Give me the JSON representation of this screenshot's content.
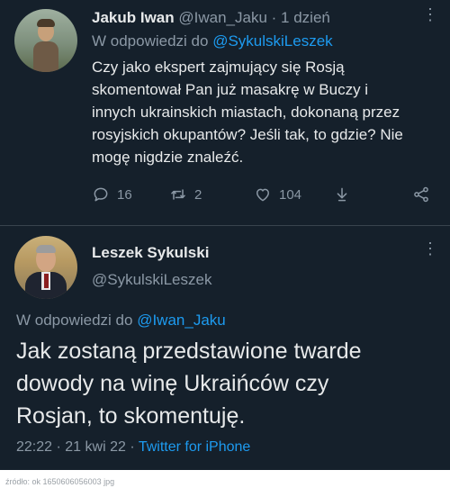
{
  "reply_tweet": {
    "author_name": "Jakub Iwan",
    "author_handle": "@Iwan_Jaku",
    "time_separator": "·",
    "time": "1 dzień",
    "replying_to_prefix": "W odpowiedzi do",
    "replying_to_handle": "@SykulskiLeszek",
    "text_lines": [
      "Czy jako ekspert zajmujący się Rosją",
      "skomentował Pan już masakrę w Buczy i",
      "innych ukrainskich miastach, dokonaną przez",
      "rosyjskich okupantów? Jeśli tak, to gdzie? Nie",
      "mogę nigdzie znaleźć."
    ],
    "actions": {
      "replies": "16",
      "retweets": "2",
      "likes": "104"
    },
    "more_glyph": "⋮"
  },
  "main_tweet": {
    "author_name": "Leszek Sykulski",
    "author_handle": "@SykulskiLeszek",
    "more_glyph": "⋮",
    "replying_to_prefix": "W odpowiedzi do",
    "replying_to_handle": "@Iwan_Jaku",
    "text_lines": [
      "Jak zostaną przedstawione twarde",
      "dowody na winę Ukraińców czy",
      "Rosjan, to skomentuję."
    ],
    "time": "22:22",
    "date": "21 kwi 22",
    "separator": "·",
    "source": "Twitter for iPhone"
  },
  "icons": [
    "reply-icon",
    "retweet-icon",
    "like-icon",
    "download-icon",
    "share-icon",
    "more-icon"
  ],
  "colors": {
    "background": "#15202b",
    "text": "#e7e9ea",
    "muted": "#8b98a5",
    "link": "#1d9bf0",
    "divider": "#38444d"
  },
  "caption": "źródło: ok 1650606056003 jpg"
}
